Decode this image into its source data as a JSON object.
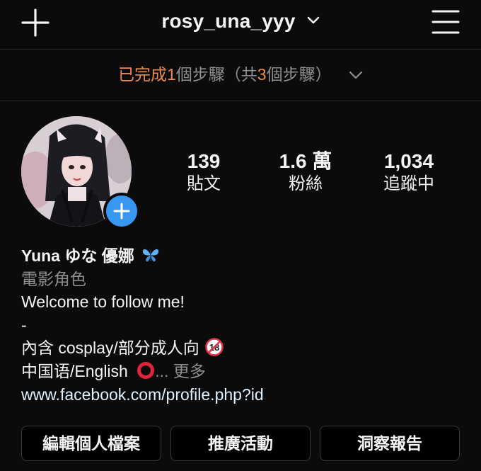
{
  "header": {
    "username": "rosy_una_yyy",
    "icons": {
      "left": "plus-icon",
      "username_toggle": "chevron-down-icon",
      "right": "hamburger-menu-icon"
    }
  },
  "steps_banner": {
    "part1": "已完成",
    "count_done": "1",
    "part2": "個步驟",
    "part3": "（共",
    "count_total": "3",
    "part4": "個步驟）",
    "icon": "chevron-down-icon",
    "highlight_color": "#f08a4b"
  },
  "profile": {
    "avatar_badge_icon": "add-icon",
    "avatar_badge_color": "#3897f0",
    "stats": [
      {
        "value": "139",
        "label": "貼文"
      },
      {
        "value": "1.6 萬",
        "label": "粉絲"
      },
      {
        "value": "1,034",
        "label": "追蹤中"
      }
    ]
  },
  "bio": {
    "name": "Yuna ゆな 優娜",
    "name_emoji": "butterfly",
    "category": "電影角色",
    "line1": "Welcome to follow me!",
    "line2": "-",
    "line3": "內含 cosplay/部分成人向",
    "line3_emoji": "no-one-under-18",
    "line4": "中国语/English",
    "line4_emoji": "hollow-red-circle",
    "more_ellipsis": "... ",
    "more_label": "更多",
    "link": "www.facebook.com/profile.php?id"
  },
  "actions": {
    "edit_profile": "編輯個人檔案",
    "promotions": "推廣活動",
    "insights": "洞察報告"
  }
}
